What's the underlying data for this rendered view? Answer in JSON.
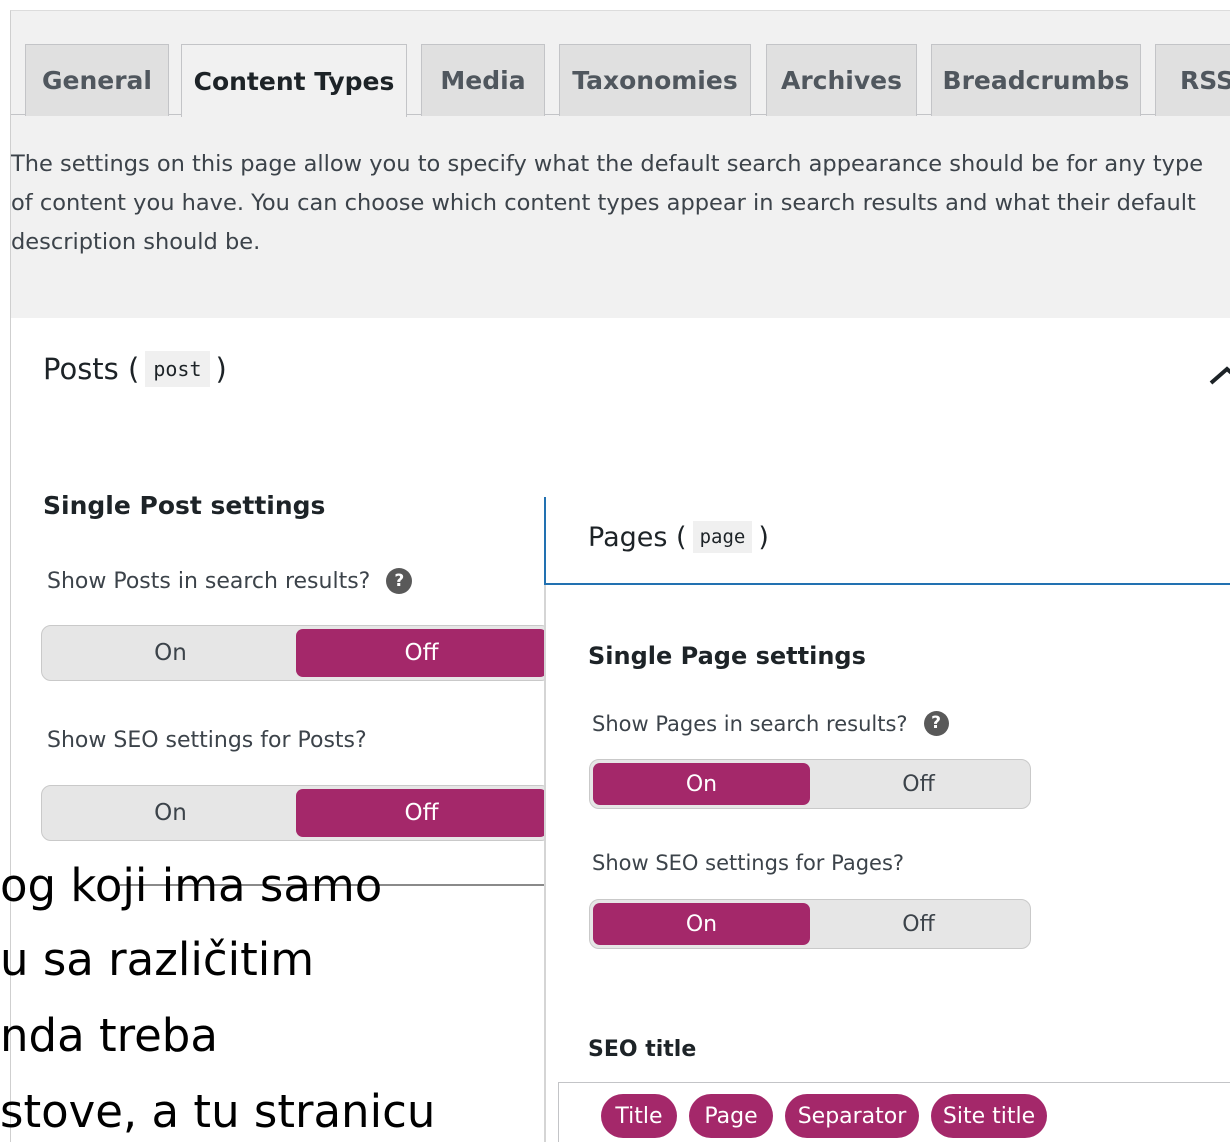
{
  "tabs": [
    {
      "label": "General"
    },
    {
      "label": "Content Types"
    },
    {
      "label": "Media"
    },
    {
      "label": "Taxonomies"
    },
    {
      "label": "Archives"
    },
    {
      "label": "Breadcrumbs"
    },
    {
      "label": "RSS"
    }
  ],
  "intro": "The settings on this page allow you to specify what the default search appearance should be for any type of content you have. You can choose which content types appear in search results and what their default description should be.",
  "posts": {
    "title": "Posts (",
    "code": "post",
    "title_end": ")",
    "single_heading": "Single Post settings",
    "q_search": "Show Posts in search results?",
    "q_seo": "Show SEO settings for Posts?",
    "on_label": "On",
    "off_label": "Off"
  },
  "pages": {
    "title": "Pages (",
    "code": "page",
    "title_end": ")",
    "single_heading": "Single Page settings",
    "q_search": "Show Pages in search results?",
    "q_seo": "Show SEO settings for Pages?",
    "on_label": "On",
    "off_label": "Off",
    "seo_title_label": "SEO title",
    "pills": [
      "Title",
      "Page",
      "Separator",
      "Site title"
    ]
  },
  "help_glyph": "?",
  "caption_lines": [
    "og koji ima samo",
    "u sa različitim",
    "nda treba",
    "stove, a tu stranicu"
  ],
  "colors": {
    "accent": "#a4286a",
    "focus": "#2271b1"
  }
}
